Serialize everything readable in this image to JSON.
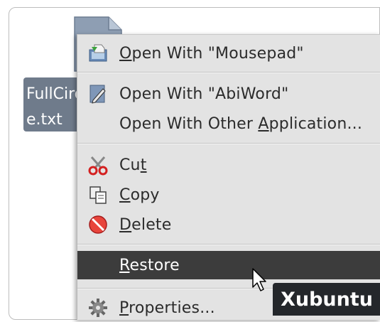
{
  "file": {
    "name_line1": "FullCirc",
    "name_line2": "e.txt",
    "icon": "text-file-icon"
  },
  "menu": {
    "items": [
      {
        "pre": "",
        "mnemonic": "O",
        "post": "pen With \"Mousepad\"",
        "icon": "mousepad-icon"
      },
      {
        "pre": "Open With \"AbiWord\"",
        "mnemonic": "",
        "post": "",
        "icon": "abiword-icon"
      },
      {
        "pre": "Open With Other ",
        "mnemonic": "A",
        "post": "pplication...",
        "icon": ""
      },
      {
        "pre": "Cu",
        "mnemonic": "t",
        "post": "",
        "icon": "scissors-icon"
      },
      {
        "pre": "",
        "mnemonic": "C",
        "post": "opy",
        "icon": "copy-icon"
      },
      {
        "pre": "",
        "mnemonic": "D",
        "post": "elete",
        "icon": "delete-icon"
      },
      {
        "pre": "",
        "mnemonic": "R",
        "post": "estore",
        "icon": "",
        "selected": true
      },
      {
        "pre": "",
        "mnemonic": "P",
        "post": "roperties...",
        "icon": "gear-icon"
      }
    ]
  },
  "watermark": "Xubuntu",
  "colors": {
    "menu_bg": "#e3e3e3",
    "selected_bg": "#3c3c3c",
    "file_label_bg": "#6f7b8b",
    "watermark_bg": "#24272b"
  }
}
